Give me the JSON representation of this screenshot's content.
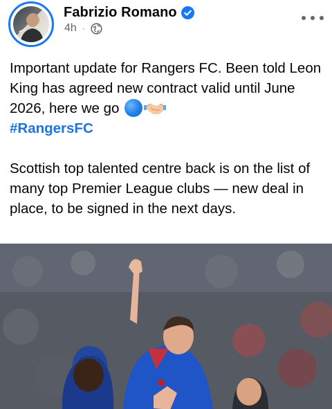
{
  "post": {
    "author": "Fabrizio Romano",
    "time": "4h",
    "separator": "·",
    "paragraph1": "Important update for Rangers FC. Been told Leon King has agreed new contract valid until June 2026, here we go",
    "hashtag": "#RangersFC",
    "paragraph2": "Scottish top talented centre back is on the list of many top Premier League clubs — new deal in place, to be signed in the next days."
  },
  "icons": {
    "verified": "verified-badge-icon",
    "audience": "globe-icon",
    "more": "more-options-icon",
    "emoji1": "blue-circle-emoji",
    "emoji2": "handshake-emoji"
  },
  "colors": {
    "accent": "#1877f2",
    "hashtag": "#1b74e4",
    "text": "#050505",
    "meta": "#65676b"
  }
}
